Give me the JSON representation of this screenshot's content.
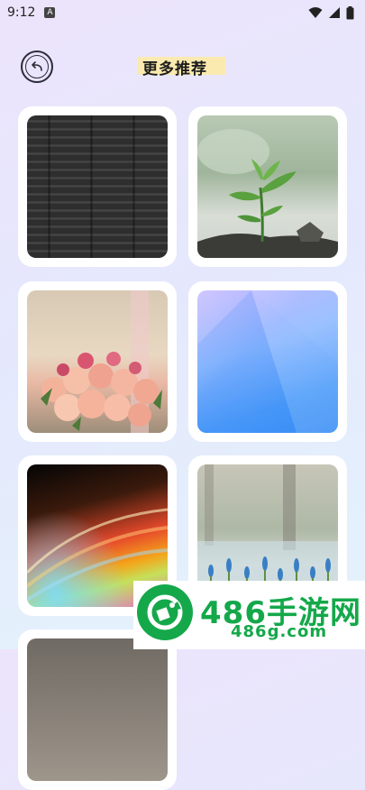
{
  "status_bar": {
    "time": "9:12",
    "notification_glyph": "A"
  },
  "header": {
    "title": "更多推荐",
    "back_icon": "back-arrow-icon"
  },
  "wallpapers": [
    {
      "label": "dark-wood-texture"
    },
    {
      "label": "green-sprout"
    },
    {
      "label": "pink-roses-bouquet"
    },
    {
      "label": "blue-gradient-abstract"
    },
    {
      "label": "colorful-light-streaks"
    },
    {
      "label": "blue-hyacinth-field"
    },
    {
      "label": "partial-thumbnail"
    }
  ],
  "watermark": {
    "text": "486手游网",
    "sub": "486g.com"
  },
  "colors": {
    "accent_green": "#14a84a",
    "title_highlight": "#fbeab0"
  }
}
